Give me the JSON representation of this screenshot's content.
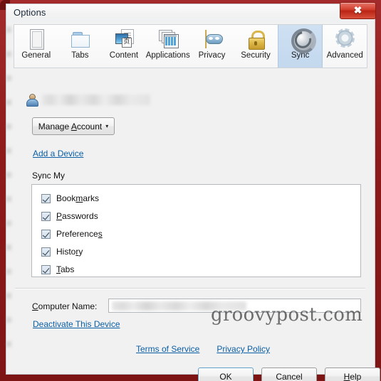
{
  "window": {
    "title": "Options",
    "close_label": "✖",
    "close_icon": "close-icon"
  },
  "toolbar": {
    "tabs": [
      {
        "label": "General",
        "icon": "general-document-icon",
        "selected": false
      },
      {
        "label": "Tabs",
        "icon": "folder-icon",
        "selected": false
      },
      {
        "label": "Content",
        "icon": "content-image-page-icon",
        "selected": false
      },
      {
        "label": "Applications",
        "icon": "applications-windows-icon",
        "selected": false
      },
      {
        "label": "Privacy",
        "icon": "privacy-mask-icon",
        "selected": false
      },
      {
        "label": "Security",
        "icon": "security-padlock-icon",
        "selected": false
      },
      {
        "label": "Sync",
        "icon": "sync-circular-arrows-icon",
        "selected": true
      },
      {
        "label": "Advanced",
        "icon": "advanced-gear-icon",
        "selected": false
      }
    ]
  },
  "account": {
    "avatar_icon": "user-avatar-icon",
    "name_redacted": "",
    "manage_button": {
      "label": "Manage Account",
      "accesskey": "A",
      "caret": "▾"
    },
    "add_device_link": "Add a Device"
  },
  "sync": {
    "group_label": "Sync My",
    "items": [
      {
        "label": "Bookmarks",
        "checked": true
      },
      {
        "label": "Passwords",
        "checked": true
      },
      {
        "label": "Preferences",
        "checked": true
      },
      {
        "label": "History",
        "checked": true
      },
      {
        "label": "Tabs",
        "checked": true
      }
    ]
  },
  "device": {
    "computer_name_label": "Computer Name:",
    "computer_name_value": "",
    "deactivate_link": "Deactivate This Device"
  },
  "legal": {
    "terms_link": "Terms of Service",
    "privacy_link": "Privacy Policy"
  },
  "footer": {
    "ok": "OK",
    "cancel": "Cancel",
    "help": "Help"
  },
  "watermark": {
    "text": "groovypost.com"
  },
  "colors": {
    "frame": "#8e1d1d",
    "dialog_bg": "#f1f1f1",
    "selected_tab": "#c8dcf0",
    "link": "#0b5fa5",
    "close_button": "#c62d18",
    "default_button_border": "#5c9fcb"
  }
}
